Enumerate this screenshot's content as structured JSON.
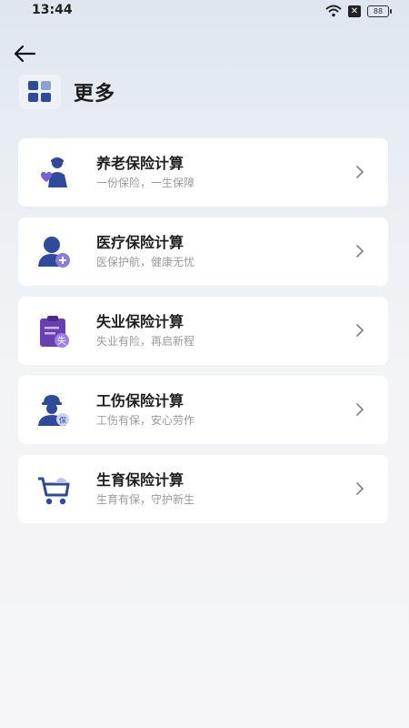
{
  "status_bar": {
    "time": "13:44",
    "battery": "88",
    "sim_badge": "✕"
  },
  "header": {
    "title": "更多"
  },
  "cards": [
    {
      "title": "养老保险计算",
      "subtitle": "一份保险，一生保障",
      "icon": "elderly-care-icon"
    },
    {
      "title": "医疗保险计算",
      "subtitle": "医保护航，健康无忧",
      "icon": "medical-person-icon"
    },
    {
      "title": "失业保险计算",
      "subtitle": "失业有险，再启新程",
      "icon": "unemployment-clipboard-icon"
    },
    {
      "title": "工伤保险计算",
      "subtitle": "工伤有保，安心劳作",
      "icon": "work-injury-helmet-icon"
    },
    {
      "title": "生育保险计算",
      "subtitle": "生育有保，守护新生",
      "icon": "baby-stroller-icon"
    }
  ],
  "colors": {
    "accent": "#2f4a9b",
    "purple": "#7a5fd6",
    "card_bg": "#ffffff"
  }
}
